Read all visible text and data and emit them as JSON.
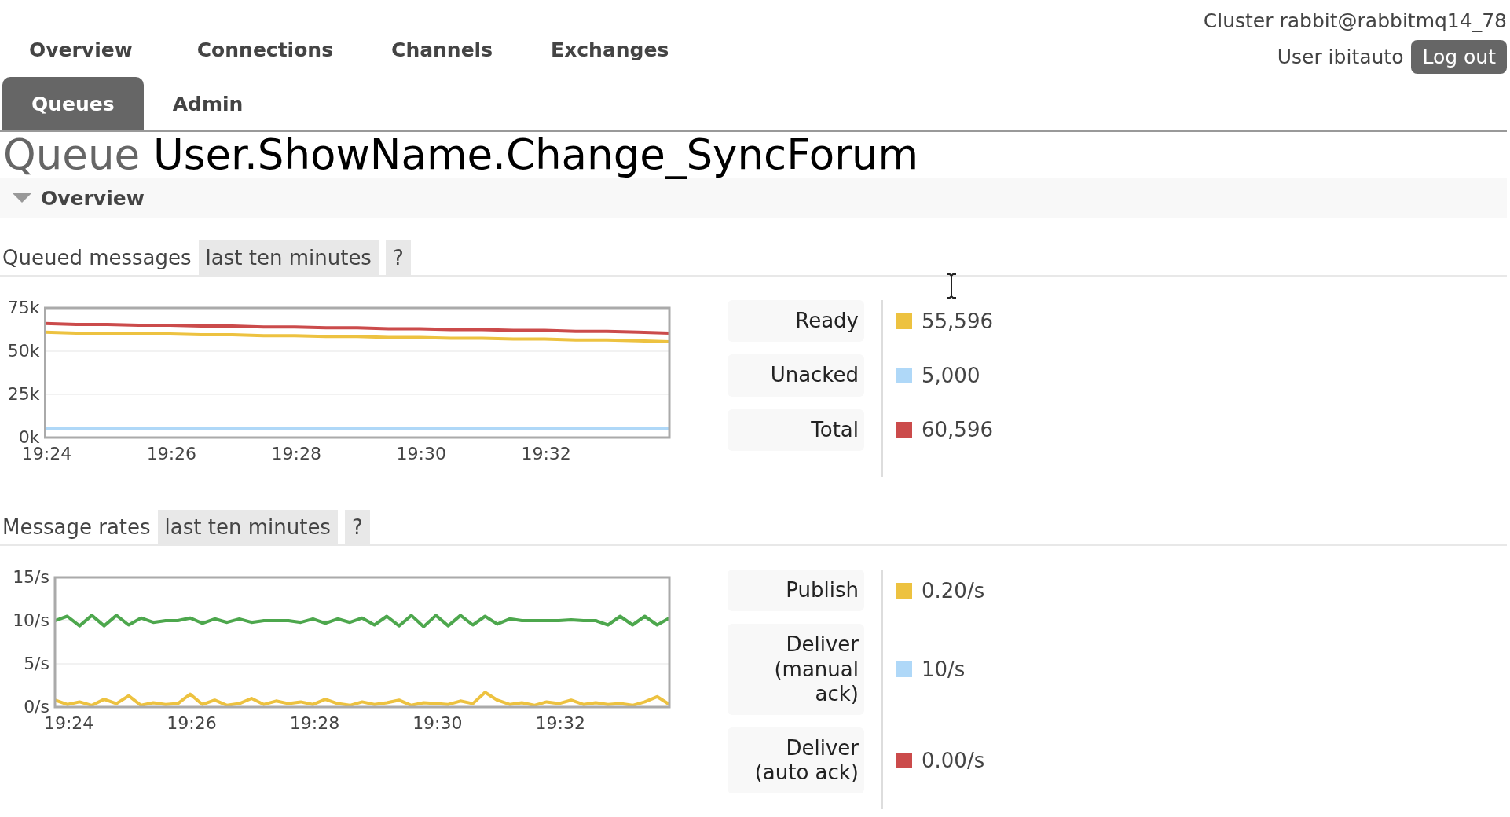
{
  "header": {
    "cluster": "Cluster rabbit@rabbitmq14_78",
    "user": "User ibitauto",
    "logout": "Log out"
  },
  "nav_rows": [
    [
      {
        "label": "Overview",
        "selected": false
      },
      {
        "label": "Connections",
        "selected": false
      },
      {
        "label": "Channels",
        "selected": false
      },
      {
        "label": "Exchanges",
        "selected": false
      }
    ],
    [
      {
        "label": "Queues",
        "selected": true
      },
      {
        "label": "Admin",
        "selected": false
      }
    ]
  ],
  "title": {
    "prefix": "Queue",
    "name": "User.ShowName.Change_SyncForum"
  },
  "section": {
    "title": "Overview",
    "expanded": true
  },
  "panels": [
    {
      "heading": "Queued messages",
      "range": "last ten minutes",
      "help": "?",
      "chart_data": {
        "type": "line",
        "categories": [
          "19:24",
          null,
          null,
          null,
          "19:26",
          null,
          null,
          null,
          "19:28",
          null,
          null,
          null,
          "19:30",
          null,
          null,
          null,
          "19:32",
          null,
          null,
          null,
          null
        ],
        "ylim": [
          0,
          75000
        ],
        "yticks": [
          {
            "value": 0,
            "label": "0k"
          },
          {
            "value": 25000,
            "label": "25k"
          },
          {
            "value": 50000,
            "label": "50k"
          },
          {
            "value": 75000,
            "label": "75k"
          }
        ],
        "series": [
          {
            "color": "#afd8f8",
            "values": [
              5000,
              5000,
              5000,
              5000,
              5000,
              5000,
              5000,
              5000,
              5000,
              5000,
              5000,
              5000,
              5000,
              5000,
              5000,
              5000,
              5000,
              5000,
              5000,
              5000,
              5000
            ]
          },
          {
            "color": "#edc240",
            "values": [
              61000,
              60500,
              60500,
              60000,
              60000,
              59500,
              59500,
              59000,
              59000,
              58500,
              58500,
              58000,
              58000,
              57500,
              57500,
              57000,
              57000,
              56500,
              56500,
              56000,
              55500
            ]
          },
          {
            "color": "#cb4b4b",
            "values": [
              66000,
              65500,
              65500,
              65000,
              65000,
              64500,
              64500,
              64000,
              64000,
              63500,
              63500,
              63000,
              63000,
              62500,
              62500,
              62000,
              62000,
              61500,
              61500,
              61000,
              60500
            ]
          }
        ]
      },
      "legend": [
        {
          "label": "Ready",
          "color": "#edc240",
          "value": "55,596"
        },
        {
          "label": "Unacked",
          "color": "#afd8f8",
          "value": "5,000"
        },
        {
          "label": "Total",
          "color": "#cb4b4b",
          "value": "60,596"
        }
      ]
    },
    {
      "heading": "Message rates",
      "range": "last ten minutes",
      "help": "?",
      "chart_data": {
        "type": "line",
        "categories": [
          null,
          "19:24",
          null,
          null,
          null,
          null,
          null,
          null,
          null,
          null,
          null,
          "19:26",
          null,
          null,
          null,
          null,
          null,
          null,
          null,
          null,
          null,
          "19:28",
          null,
          null,
          null,
          null,
          null,
          null,
          null,
          null,
          null,
          "19:30",
          null,
          null,
          null,
          null,
          null,
          null,
          null,
          null,
          null,
          "19:32",
          null,
          null,
          null,
          null,
          null,
          null,
          null,
          null,
          null
        ],
        "ylim": [
          0,
          15
        ],
        "yticks": [
          {
            "value": 0,
            "label": "0/s"
          },
          {
            "value": 5,
            "label": "5/s"
          },
          {
            "value": 10,
            "label": "10/s"
          },
          {
            "value": 15,
            "label": "15/s"
          }
        ],
        "series": [
          {
            "color": "#4da74d",
            "values": [
              10,
              10.5,
              9.4,
              10.6,
              9.4,
              10.6,
              9.5,
              10.3,
              9.8,
              10,
              10,
              10.3,
              9.7,
              10.2,
              9.8,
              10.2,
              9.8,
              10,
              10,
              10,
              9.8,
              10.2,
              9.7,
              10.2,
              9.8,
              10.3,
              9.5,
              10.5,
              9.4,
              10.6,
              9.3,
              10.6,
              9.4,
              10.6,
              9.5,
              10.5,
              9.6,
              10.2,
              10,
              10,
              10,
              10,
              10.1,
              10,
              10,
              9.5,
              10.5,
              9.5,
              10.5,
              9.5,
              10.3
            ]
          },
          {
            "color": "#edc240",
            "values": [
              0.8,
              0.3,
              0.6,
              0.2,
              0.9,
              0.4,
              1.3,
              0.2,
              0.5,
              0.3,
              0.4,
              1.5,
              0.3,
              0.8,
              0.2,
              0.4,
              1.0,
              0.3,
              0.7,
              0.4,
              0.6,
              0.3,
              0.9,
              0.4,
              0.2,
              0.6,
              0.3,
              0.5,
              0.8,
              0.2,
              0.5,
              0.4,
              0.3,
              0.7,
              0.4,
              1.7,
              0.8,
              0.3,
              0.5,
              0.2,
              0.6,
              0.4,
              0.8,
              0.3,
              0.5,
              0.3,
              0.4,
              0.2,
              0.6,
              1.2,
              0.3
            ]
          }
        ]
      },
      "legend": [
        {
          "label": "Publish",
          "color": "#edc240",
          "value": "0.20/s"
        },
        {
          "label": "Deliver\n(manual\nack)",
          "color": "#afd8f8",
          "value": "10/s"
        },
        {
          "label": "Deliver\n(auto ack)",
          "color": "#cb4b4b",
          "value": "0.00/s"
        }
      ]
    }
  ]
}
